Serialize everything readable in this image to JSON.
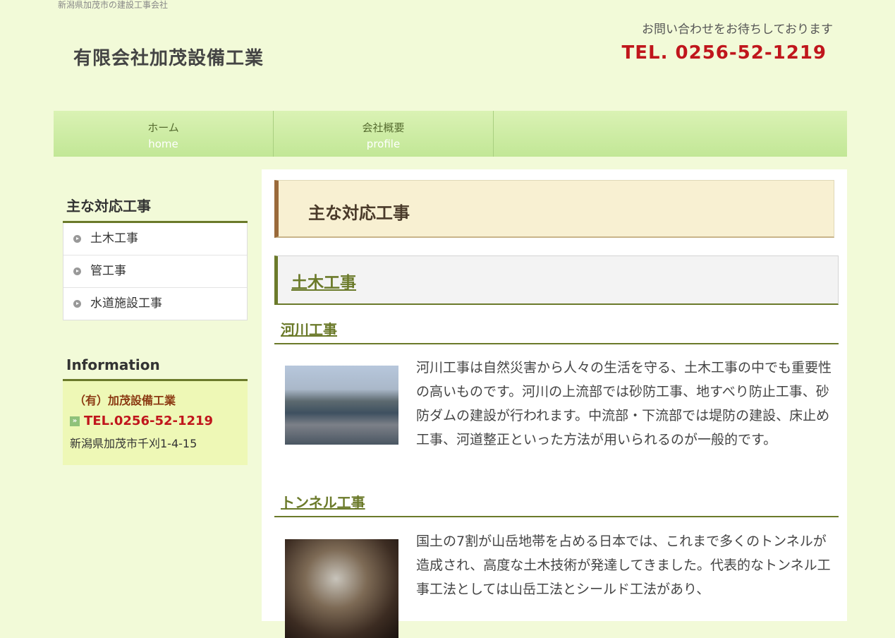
{
  "header": {
    "tagline": "新潟県加茂市の建設工事会社",
    "site_title": "有限会社加茂設備工業",
    "contact_message": "お問い合わせをお待ちしております",
    "tel": "TEL. 0256-52-1219"
  },
  "global_nav": [
    {
      "label_ja": "ホーム",
      "label_en": "home"
    },
    {
      "label_ja": "会社概要",
      "label_en": "profile"
    }
  ],
  "sidebar": {
    "menu_heading": "主な対応工事",
    "menu_items": [
      {
        "label": "土木工事",
        "icon": "bullet-arrow-icon"
      },
      {
        "label": "管工事",
        "icon": "bullet-arrow-icon"
      },
      {
        "label": "水道施設工事",
        "icon": "bullet-arrow-icon"
      }
    ],
    "info_heading": "Information",
    "info": {
      "company": "（有）加茂設備工業",
      "tel": "TEL.0256-52-1219",
      "address": "新潟県加茂市千刈1-4-15"
    }
  },
  "main": {
    "page_title": "主な対応工事",
    "section_heading": "土木工事",
    "subsections": [
      {
        "heading": "河川工事",
        "text": "河川工事は自然災害から人々の生活を守る、土木工事の中でも重要性の高いものです。河川の上流部では砂防工事、地すべり防止工事、砂防ダムの建設が行われます。中流部・下流部では堤防の建設、床止め工事、河道整正といった方法が用いられるのが一般的です。"
      },
      {
        "heading": "トンネル工事",
        "text": "国土の7割が山岳地帯を占める日本では、これまで多くのトンネルが造成され、高度な土木技術が発達してきました。代表的なトンネル工事工法としては山岳工法とシールド工法があり、"
      }
    ]
  },
  "colors": {
    "background": "#f2fad8",
    "accent_red": "#c0161c",
    "heading_olive": "#6b7a2a",
    "nav_green": "#c2e796"
  }
}
